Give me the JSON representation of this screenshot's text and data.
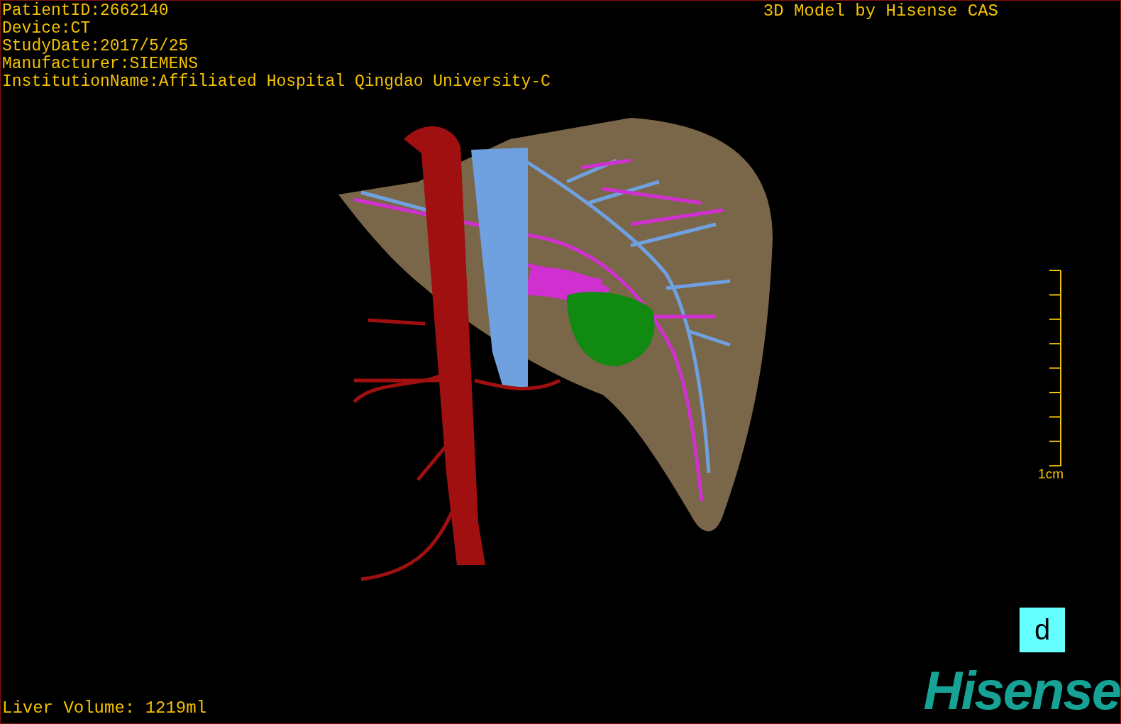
{
  "study_info": [
    "PatientID:2662140",
    "Device:CT",
    "StudyDate:2017/5/25",
    "Manufacturer:SIEMENS",
    "InstitutionName:Affiliated Hospital Qingdao University-C"
  ],
  "title": "3D Model by Hisense CAS",
  "scale_bar": {
    "label": "1cm"
  },
  "orientation_marker": {
    "label": "d"
  },
  "liver_volume": "Liver Volume: 1219ml",
  "logo": "Hisense"
}
